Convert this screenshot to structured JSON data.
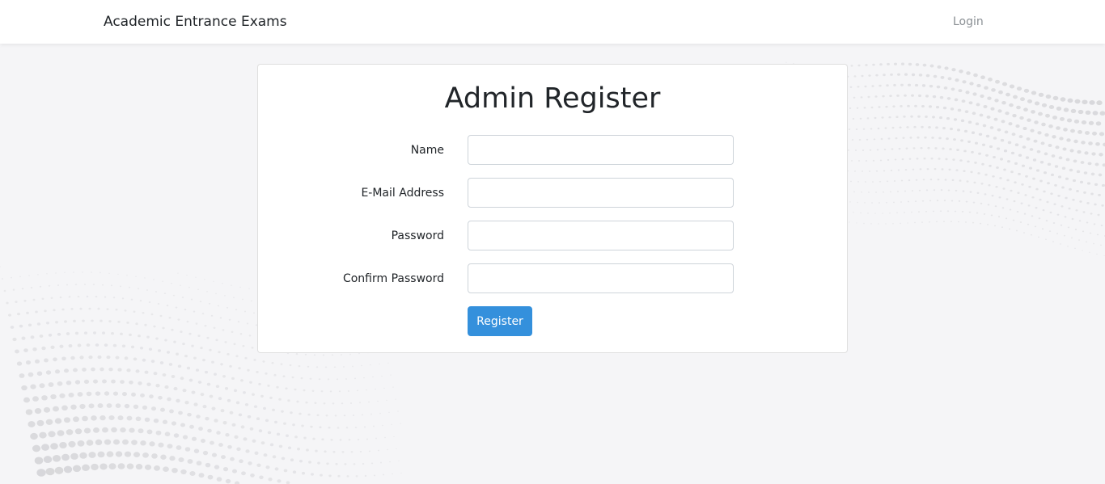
{
  "navbar": {
    "brand": "Academic Entrance Exams",
    "login_link": "Login"
  },
  "card": {
    "title": "Admin Register",
    "fields": [
      {
        "label": "Name",
        "value": "",
        "placeholder": ""
      },
      {
        "label": "E-Mail Address",
        "value": "",
        "placeholder": ""
      },
      {
        "label": "Password",
        "value": "",
        "placeholder": ""
      },
      {
        "label": "Confirm Password",
        "value": "",
        "placeholder": ""
      }
    ],
    "submit_label": "Register"
  },
  "colors": {
    "primary_button": "#3490dc",
    "page_background": "#f5f5f7",
    "card_background": "#ffffff"
  }
}
